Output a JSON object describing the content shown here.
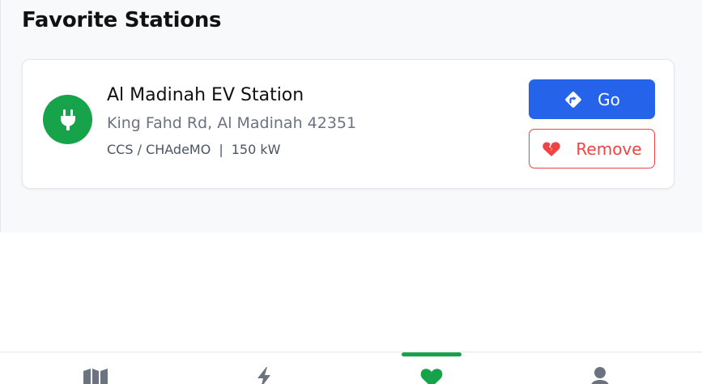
{
  "page": {
    "title": "Favorite Stations"
  },
  "station": {
    "name": "Al Madinah EV Station",
    "address": "King Fahd Rd, Al Madinah 42351",
    "connectors": "CCS / CHAdeMO",
    "separator": "|",
    "power": "150 kW",
    "icon": "plug-icon"
  },
  "actions": {
    "go_label": "Go",
    "go_icon": "directions-icon",
    "remove_label": "Remove",
    "remove_icon": "broken-heart-icon"
  },
  "nav": {
    "items": [
      {
        "icon": "map-icon",
        "active": false
      },
      {
        "icon": "bolt-icon",
        "active": false
      },
      {
        "icon": "heart-icon",
        "active": true
      },
      {
        "icon": "user-icon",
        "active": false
      }
    ]
  },
  "colors": {
    "brand_green": "#16a34a",
    "primary_blue": "#2563eb",
    "danger_red": "#ef4444",
    "nav_gray": "#6b7280"
  }
}
